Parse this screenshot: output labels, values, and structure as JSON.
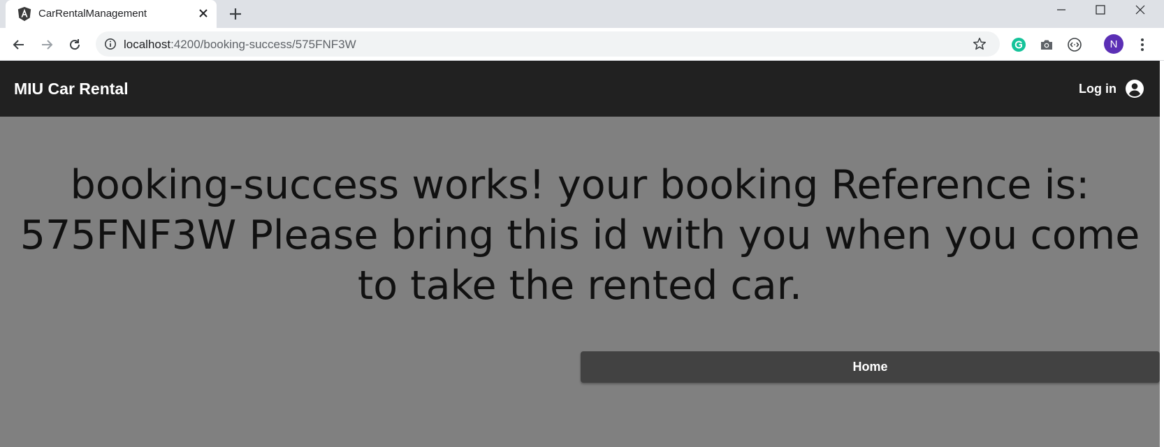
{
  "browser": {
    "tab_title": "CarRentalManagement",
    "url_host": "localhost",
    "url_path": ":4200/booking-success/575FNF3W",
    "profile_initial": "N"
  },
  "app": {
    "title": "MIU Car Rental",
    "login_label": "Log in",
    "message": "booking-success works! your booking Reference is: 575FNF3W Please bring this id with you when you come to take the rented car.",
    "home_label": "Home"
  },
  "colors": {
    "app_bar": "#212121",
    "page_background": "#808080",
    "home_button": "#424242",
    "profile_avatar": "#5b2fb5",
    "grammarly": "#15c39a"
  },
  "icons": [
    "angular-icon",
    "close-icon",
    "plus-icon",
    "minimize-icon",
    "maximize-icon",
    "window-close-icon",
    "back-arrow-icon",
    "forward-arrow-icon",
    "reload-icon",
    "info-icon",
    "star-icon",
    "grammarly-icon",
    "camera-icon",
    "code-icon",
    "kebab-menu-icon",
    "account-circle-icon"
  ]
}
